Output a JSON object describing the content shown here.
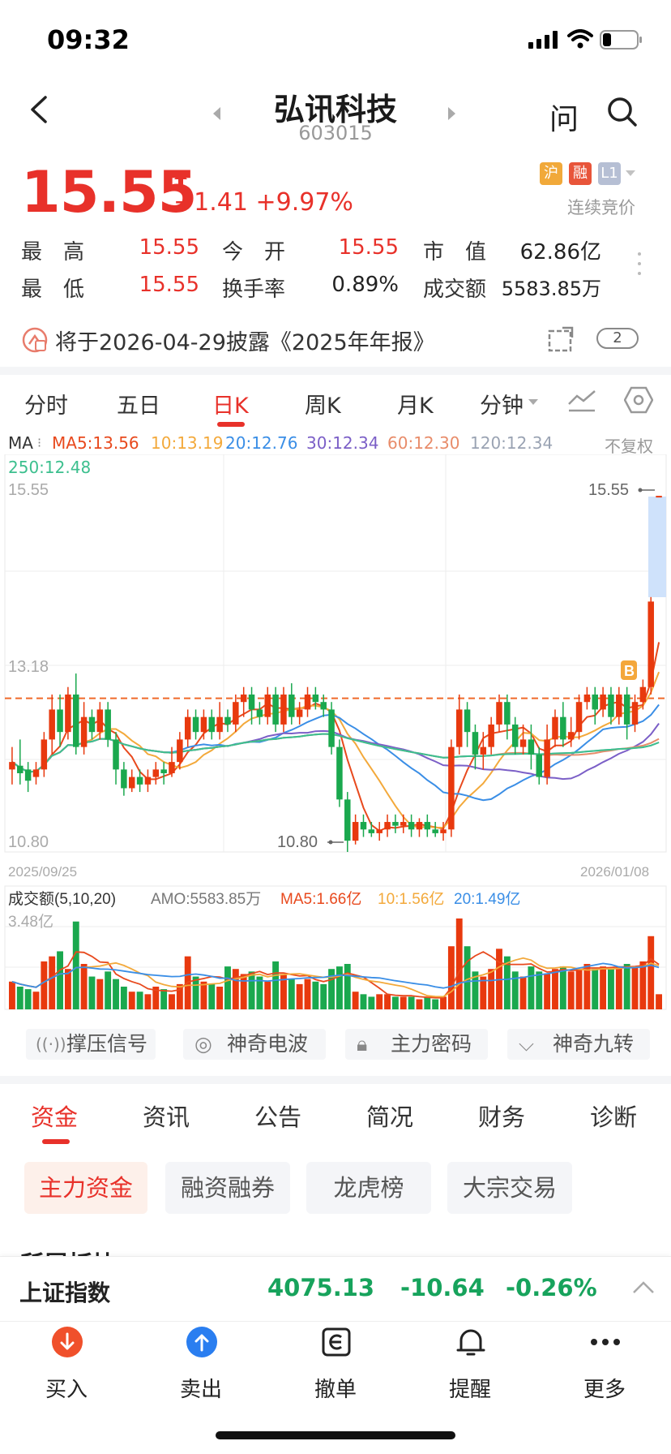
{
  "status_bar": {
    "time": "09:32"
  },
  "header": {
    "name": "弘讯科技",
    "code": "603015",
    "ask_label": "问"
  },
  "quote": {
    "price": "15.55",
    "change": "+1.41",
    "change_pct": "+9.97%",
    "tags": [
      "沪",
      "融",
      "L1"
    ],
    "auction_status": "连续竞价",
    "stats": [
      {
        "label": "最　高",
        "value": "15.55",
        "color": "#e8312a"
      },
      {
        "label": "今　开",
        "value": "15.55",
        "color": "#e8312a"
      },
      {
        "label": "市　值",
        "value": "62.86亿",
        "color": "#222222"
      },
      {
        "label": "最　低",
        "value": "15.55",
        "color": "#e8312a"
      },
      {
        "label": "换手率",
        "value": "0.89%",
        "color": "#222222"
      },
      {
        "label": "成交额",
        "value": "5583.85万",
        "color": "#222222"
      }
    ]
  },
  "notice": {
    "text": "将于2026-04-29披露《2025年年报》",
    "count": "2"
  },
  "chart_tabs": [
    "分时",
    "五日",
    "日K",
    "周K",
    "月K",
    "分钟"
  ],
  "ma_legend": {
    "prefix": "MA",
    "items": [
      {
        "text": "MA5:13.56",
        "color": "#e8491d"
      },
      {
        "text": "10:13.19",
        "color": "#f3a93b"
      },
      {
        "text": "20:12.76",
        "color": "#3a8ee6"
      },
      {
        "text": "30:12.34",
        "color": "#7b5fc7"
      },
      {
        "text": "60:12.30",
        "color": "#e88c6a"
      },
      {
        "text": "120:12.34",
        "color": "#9aa3b3"
      },
      {
        "text": "250:12.48",
        "color": "#3cbf8e"
      }
    ],
    "adjust": "不复权"
  },
  "chart_data": {
    "type": "candlestick",
    "y_axis_labels": [
      "15.55",
      "13.18",
      "10.80"
    ],
    "ylim": [
      10.8,
      15.55
    ],
    "start_date": "2025/09/25",
    "end_date": "2026/01/08",
    "high_marker": "15.55",
    "low_marker": "10.80",
    "b_marker": "B",
    "ref_line": 12.85,
    "candles": [
      [
        11.9,
        12.0,
        11.7,
        12.2
      ],
      [
        11.95,
        11.85,
        11.7,
        12.3
      ],
      [
        11.9,
        11.75,
        11.6,
        12.0
      ],
      [
        11.8,
        11.9,
        11.7,
        12.0
      ],
      [
        11.9,
        12.3,
        11.8,
        12.4
      ],
      [
        12.3,
        12.7,
        12.1,
        12.9
      ],
      [
        12.7,
        12.4,
        12.2,
        12.9
      ],
      [
        12.4,
        12.9,
        12.3,
        13.0
      ],
      [
        12.9,
        12.2,
        12.1,
        13.18
      ],
      [
        12.2,
        12.6,
        12.1,
        12.8
      ],
      [
        12.6,
        12.4,
        12.3,
        12.7
      ],
      [
        12.4,
        12.7,
        12.3,
        12.8
      ],
      [
        12.7,
        12.3,
        12.2,
        12.8
      ],
      [
        12.3,
        11.9,
        11.7,
        12.4
      ],
      [
        11.9,
        11.65,
        11.55,
        12.0
      ],
      [
        11.65,
        11.8,
        11.6,
        11.9
      ],
      [
        11.8,
        11.7,
        11.6,
        11.9
      ],
      [
        11.7,
        11.8,
        11.6,
        11.9
      ],
      [
        11.8,
        11.9,
        11.7,
        12.0
      ],
      [
        11.9,
        11.85,
        11.7,
        12.0
      ],
      [
        11.85,
        12.0,
        11.8,
        12.2
      ],
      [
        12.0,
        12.3,
        11.9,
        12.4
      ],
      [
        12.3,
        12.6,
        12.2,
        12.7
      ],
      [
        12.6,
        12.4,
        12.3,
        12.7
      ],
      [
        12.4,
        12.6,
        12.3,
        12.7
      ],
      [
        12.6,
        12.4,
        12.3,
        12.7
      ],
      [
        12.4,
        12.6,
        12.3,
        12.8
      ],
      [
        12.6,
        12.5,
        12.4,
        12.7
      ],
      [
        12.5,
        12.8,
        12.4,
        12.9
      ],
      [
        12.8,
        12.9,
        12.6,
        13.0
      ],
      [
        12.9,
        12.7,
        12.5,
        13.0
      ],
      [
        12.7,
        12.6,
        12.5,
        12.8
      ],
      [
        12.6,
        12.9,
        12.5,
        13.0
      ],
      [
        12.9,
        12.5,
        12.4,
        13.0
      ],
      [
        12.5,
        12.9,
        12.4,
        13.0
      ],
      [
        12.9,
        12.6,
        12.5,
        13.05
      ],
      [
        12.6,
        12.7,
        12.5,
        12.8
      ],
      [
        12.7,
        12.9,
        12.6,
        13.0
      ],
      [
        12.9,
        12.8,
        12.7,
        13.0
      ],
      [
        12.8,
        12.7,
        12.6,
        12.9
      ],
      [
        12.7,
        12.2,
        12.1,
        12.8
      ],
      [
        12.2,
        11.5,
        11.4,
        12.3
      ],
      [
        11.5,
        10.95,
        10.8,
        11.6
      ],
      [
        10.95,
        11.2,
        10.9,
        11.3
      ],
      [
        11.2,
        11.1,
        11.0,
        11.3
      ],
      [
        11.1,
        11.05,
        11.0,
        11.2
      ],
      [
        11.05,
        11.1,
        10.95,
        11.2
      ],
      [
        11.1,
        11.2,
        11.0,
        11.3
      ],
      [
        11.2,
        11.15,
        11.05,
        11.3
      ],
      [
        11.15,
        11.2,
        11.05,
        11.3
      ],
      [
        11.2,
        11.1,
        11.0,
        11.3
      ],
      [
        11.1,
        11.2,
        11.0,
        11.25
      ],
      [
        11.2,
        11.1,
        11.0,
        11.3
      ],
      [
        11.1,
        11.05,
        11.0,
        11.2
      ],
      [
        11.05,
        11.1,
        10.95,
        11.2
      ],
      [
        11.1,
        12.2,
        11.0,
        12.3
      ],
      [
        12.2,
        12.7,
        12.1,
        12.9
      ],
      [
        12.7,
        12.4,
        12.2,
        12.8
      ],
      [
        12.4,
        12.1,
        11.9,
        12.5
      ],
      [
        12.1,
        12.2,
        11.9,
        12.4
      ],
      [
        12.2,
        12.5,
        12.1,
        12.6
      ],
      [
        12.5,
        12.8,
        12.4,
        12.9
      ],
      [
        12.8,
        12.5,
        12.3,
        12.9
      ],
      [
        12.5,
        12.2,
        12.1,
        12.6
      ],
      [
        12.2,
        12.3,
        12.1,
        12.5
      ],
      [
        12.3,
        12.1,
        11.9,
        12.5
      ],
      [
        12.1,
        11.8,
        11.7,
        12.2
      ],
      [
        11.8,
        12.3,
        11.7,
        12.5
      ],
      [
        12.3,
        12.6,
        12.2,
        12.7
      ],
      [
        12.6,
        12.3,
        12.2,
        12.8
      ],
      [
        12.3,
        12.4,
        12.2,
        12.6
      ],
      [
        12.4,
        12.8,
        12.3,
        12.9
      ],
      [
        12.8,
        12.9,
        12.7,
        13.0
      ],
      [
        12.9,
        12.7,
        12.5,
        13.0
      ],
      [
        12.7,
        12.9,
        12.6,
        13.0
      ],
      [
        12.9,
        12.6,
        12.5,
        13.0
      ],
      [
        12.6,
        12.9,
        12.5,
        13.0
      ],
      [
        12.9,
        12.5,
        12.3,
        13.0
      ],
      [
        12.5,
        12.8,
        12.4,
        12.9
      ],
      [
        12.8,
        13.0,
        12.7,
        13.1
      ],
      [
        13.0,
        14.14,
        12.9,
        14.2
      ],
      [
        15.55,
        15.55,
        15.55,
        15.55
      ]
    ],
    "volume_labels": {
      "header": "成交额(5,10,20)",
      "amo": "AMO:5583.85万",
      "ma5": "MA5:1.66亿",
      "ma10": "10:1.56亿",
      "ma20": "20:1.49亿",
      "ymax": "3.48亿"
    },
    "volumes": [
      1.1,
      0.9,
      0.8,
      0.7,
      1.9,
      2.1,
      2.3,
      1.6,
      3.48,
      1.8,
      1.3,
      1.2,
      1.5,
      1.2,
      0.9,
      0.7,
      0.7,
      0.6,
      0.9,
      0.8,
      0.6,
      1.0,
      2.1,
      1.3,
      1.1,
      1.0,
      0.9,
      1.7,
      1.6,
      1.4,
      1.5,
      1.3,
      1.1,
      1.9,
      1.4,
      1.2,
      1.0,
      1.2,
      1.1,
      1.0,
      1.6,
      1.7,
      1.8,
      0.7,
      0.6,
      0.5,
      0.6,
      0.6,
      0.5,
      0.5,
      0.5,
      0.4,
      0.5,
      0.4,
      0.5,
      2.5,
      3.6,
      2.5,
      1.5,
      1.3,
      1.6,
      2.4,
      2.1,
      1.5,
      1.3,
      1.7,
      1.5,
      1.4,
      1.6,
      1.7,
      1.5,
      1.6,
      1.8,
      1.6,
      1.7,
      1.6,
      1.7,
      1.8,
      1.7,
      1.9,
      2.9,
      0.6
    ]
  },
  "signal_buttons": [
    "撑压信号",
    "神奇电波",
    "主力密码",
    "神奇九转"
  ],
  "section_tabs": [
    "资金",
    "资讯",
    "公告",
    "简况",
    "财务",
    "诊断"
  ],
  "chips": [
    "主力资金",
    "融资融券",
    "龙虎榜",
    "大宗交易"
  ],
  "partial_heading": "所属板块",
  "index_bar": {
    "name": "上证指数",
    "value": "4075.13",
    "change": "-10.64",
    "change_pct": "-0.26%"
  },
  "bottom_nav": [
    "买入",
    "卖出",
    "撤单",
    "提醒",
    "更多"
  ]
}
